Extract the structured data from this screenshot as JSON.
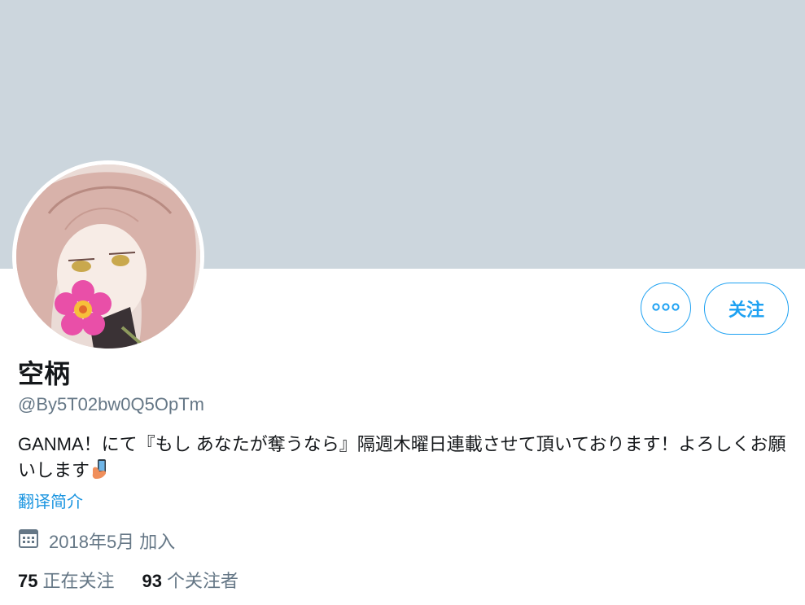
{
  "profile": {
    "name": "空柄",
    "handle": "@By5T02bw0Q5OpTm",
    "bio": "GANMA！にて『もし あなたが奪うなら』隔週木曜日連載させて頂いております！よろしくお願いします",
    "translate_label": "翻译简介",
    "joined": "2018年5月 加入"
  },
  "actions": {
    "more_icon": "more-dots-icon",
    "follow_label": "关注"
  },
  "stats": {
    "following_count": "75",
    "following_label": "正在关注",
    "followers_count": "93",
    "followers_label": "个关注者"
  },
  "colors": {
    "banner": "#ccd6dd",
    "accent": "#1da1f2",
    "secondary_text": "#657786"
  }
}
